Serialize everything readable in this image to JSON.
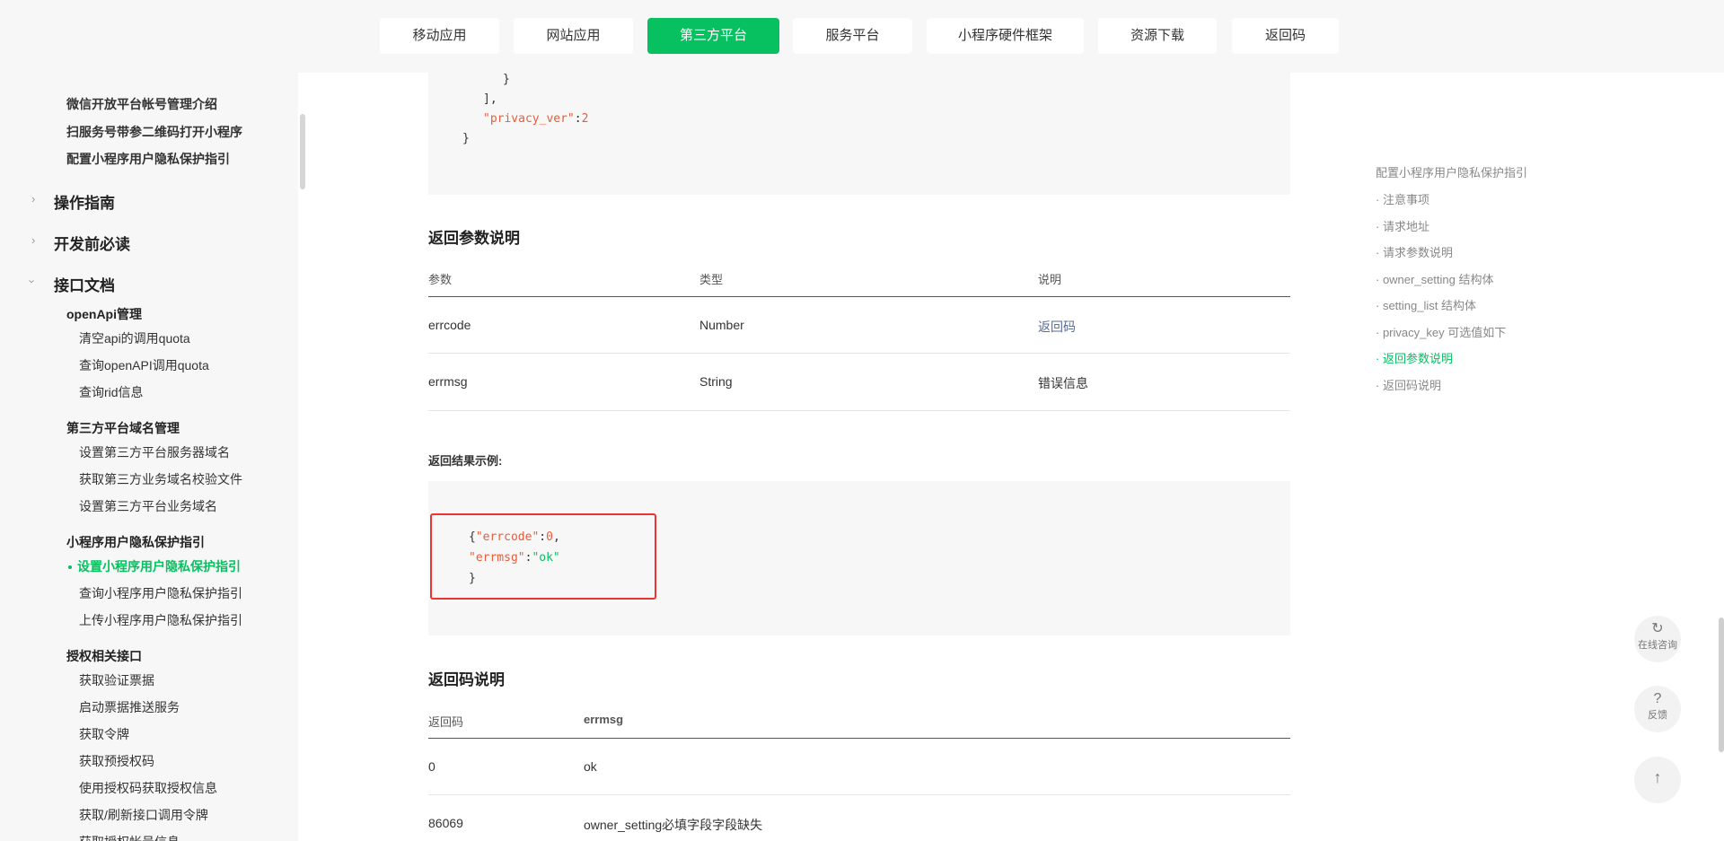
{
  "topnav": {
    "items": [
      "移动应用",
      "网站应用",
      "第三方平台",
      "服务平台",
      "小程序硬件框架",
      "资源下载",
      "返回码"
    ],
    "active_index": 2
  },
  "sidebar": {
    "top_items": [
      "微信开放平台帐号管理介绍",
      "扫服务号带参二维码打开小程序",
      "配置小程序用户隐私保护指引"
    ],
    "sections": [
      "操作指南",
      "开发前必读",
      "接口文档"
    ],
    "groups": {
      "openapi": {
        "title": "openApi管理",
        "items": [
          "清空api的调用quota",
          "查询openAPI调用quota",
          "查询rid信息"
        ]
      },
      "domain": {
        "title": "第三方平台域名管理",
        "items": [
          "设置第三方平台服务器域名",
          "获取第三方业务域名校验文件",
          "设置第三方平台业务域名"
        ]
      },
      "privacy": {
        "title": "小程序用户隐私保护指引",
        "items": [
          "设置小程序用户隐私保护指引",
          "查询小程序用户隐私保护指引",
          "上传小程序用户隐私保护指引"
        ]
      },
      "auth": {
        "title": "授权相关接口",
        "items": [
          "获取验证票据",
          "启动票据推送服务",
          "获取令牌",
          "获取预授权码",
          "使用授权码获取授权信息",
          "获取/刷新接口调用令牌",
          "获取授权帐号信息"
        ]
      }
    }
  },
  "code_top": {
    "line1": "}",
    "line2": "],",
    "key": "\"privacy_ver\"",
    "colon": ":",
    "num": "2",
    "line4": "}"
  },
  "return_params": {
    "title": "返回参数说明",
    "headers": [
      "参数",
      "类型",
      "说明"
    ],
    "rows": [
      {
        "param": "errcode",
        "type": "Number",
        "desc": "返回码"
      },
      {
        "param": "errmsg",
        "type": "String",
        "desc": "错误信息"
      }
    ]
  },
  "example": {
    "label": "返回结果示例:",
    "l1_brace": "{",
    "l1_key": "\"errcode\"",
    "l1_colon": ":",
    "l1_val": "0",
    "l1_comma": ",",
    "l2_key": "\"errmsg\"",
    "l2_colon": ":",
    "l2_val": "\"ok\"",
    "l3": "}"
  },
  "return_codes": {
    "title": "返回码说明",
    "headers": [
      "返回码",
      "errmsg"
    ],
    "rows": [
      {
        "code": "0",
        "msg": "ok"
      },
      {
        "code": "86069",
        "msg": "owner_setting必填字段字段缺失"
      }
    ]
  },
  "toc": {
    "items": [
      "配置小程序用户隐私保护指引",
      "· 注意事项",
      "· 请求地址",
      "· 请求参数说明",
      "· owner_setting 结构体",
      "· setting_list 结构体",
      "· privacy_key 可选值如下",
      "· 返回参数说明",
      "· 返回码说明"
    ],
    "active_index": 7
  },
  "fabs": {
    "consult_icon": "↻",
    "consult_label": "在线咨询",
    "feedback_icon": "?",
    "feedback_label": "反馈",
    "top_icon": "↑"
  },
  "colors": {
    "accent": "#07c160",
    "link": "#576b95",
    "highlight": "#e33333"
  }
}
